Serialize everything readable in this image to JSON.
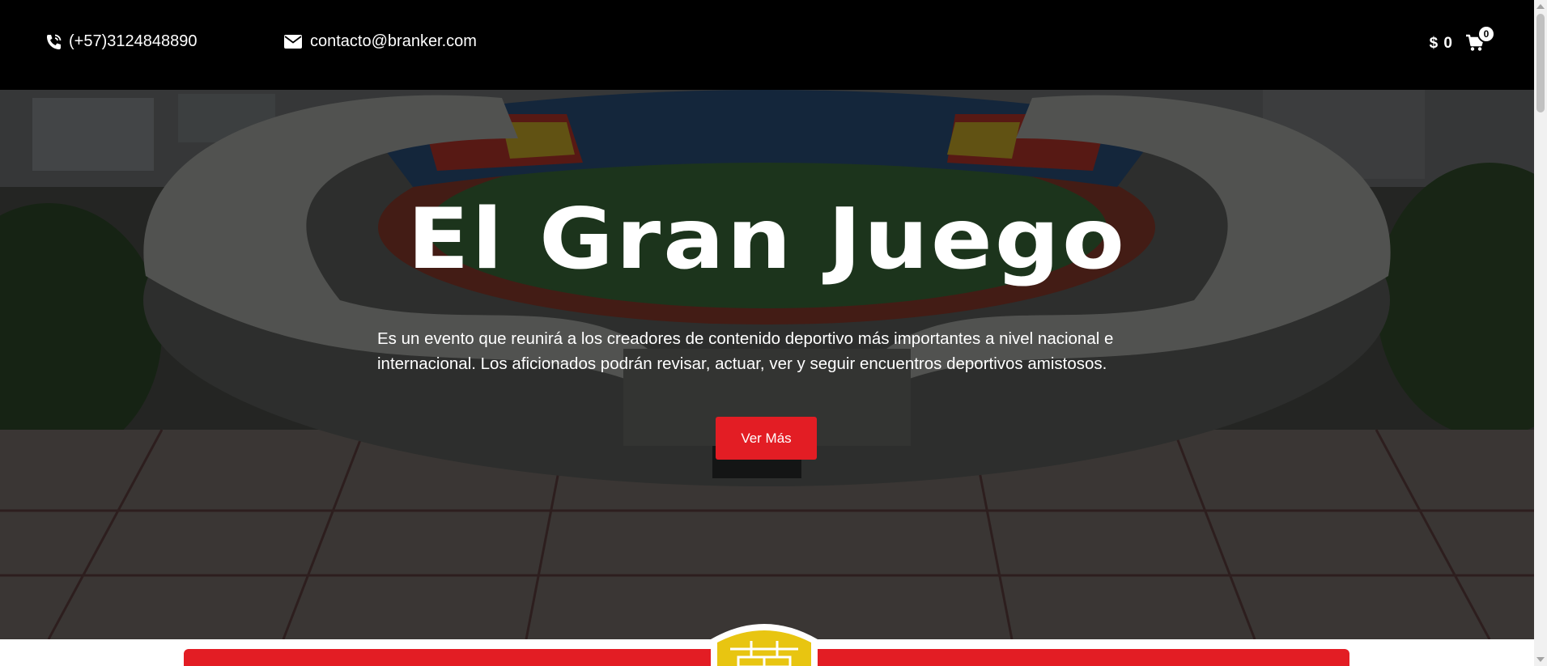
{
  "header": {
    "phone": "(+57)3124848890",
    "email": "contacto@branker.com",
    "cart_total": "$ 0",
    "cart_count": "0",
    "icons": [
      "phone-icon",
      "envelope-icon",
      "cart-icon"
    ]
  },
  "hero": {
    "title": "El Gran Juego",
    "description": "Es un evento que reunirá a los creadores de contenido deportivo más importantes a nivel nacional e internacional. Los aficionados podrán revisar, actuar, ver y seguir encuentros deportivos amistosos.",
    "button_label": "Ver Más",
    "background": "stadium-aerial-photo"
  },
  "colors": {
    "topbar": "#000000",
    "accent": "#e31d24",
    "crest": "#e8c511"
  }
}
